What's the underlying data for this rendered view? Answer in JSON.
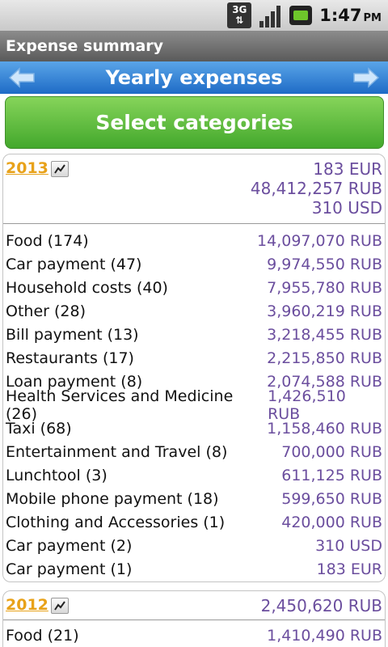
{
  "status_bar": {
    "network": "3G",
    "time": "1:47",
    "ampm": "PM"
  },
  "title": "Expense summary",
  "nav": {
    "title": "Yearly expenses",
    "prev_icon": "arrow-left-icon",
    "next_icon": "arrow-right-icon"
  },
  "select_button": "Select categories",
  "years": [
    {
      "year": "2013",
      "totals": [
        "183 EUR",
        "48,412,257 RUB",
        "310 USD"
      ],
      "rows": [
        {
          "name": "Food (174)",
          "amount": "14,097,070 RUB"
        },
        {
          "name": "Car payment (47)",
          "amount": "9,974,550 RUB"
        },
        {
          "name": "Household costs (40)",
          "amount": "7,955,780 RUB"
        },
        {
          "name": "Other (28)",
          "amount": "3,960,219 RUB"
        },
        {
          "name": "Bill payment (13)",
          "amount": "3,218,455 RUB"
        },
        {
          "name": "Restaurants (17)",
          "amount": "2,215,850 RUB"
        },
        {
          "name": "Loan payment (8)",
          "amount": "2,074,588 RUB"
        },
        {
          "name": "Health Services and Medicine (26)",
          "amount": "1,426,510 RUB"
        },
        {
          "name": "Taxi (68)",
          "amount": "1,158,460 RUB"
        },
        {
          "name": "Entertainment and Travel (8)",
          "amount": "700,000 RUB"
        },
        {
          "name": "Lunchtool (3)",
          "amount": "611,125 RUB"
        },
        {
          "name": "Mobile phone payment (18)",
          "amount": "599,650 RUB"
        },
        {
          "name": "Clothing and Accessories (1)",
          "amount": "420,000 RUB"
        },
        {
          "name": "Car payment (2)",
          "amount": "310 USD"
        },
        {
          "name": "Car payment (1)",
          "amount": "183 EUR"
        }
      ]
    },
    {
      "year": "2012",
      "totals": [
        "2,450,620 RUB"
      ],
      "rows": [
        {
          "name": "Food (21)",
          "amount": "1,410,490 RUB"
        }
      ]
    }
  ]
}
